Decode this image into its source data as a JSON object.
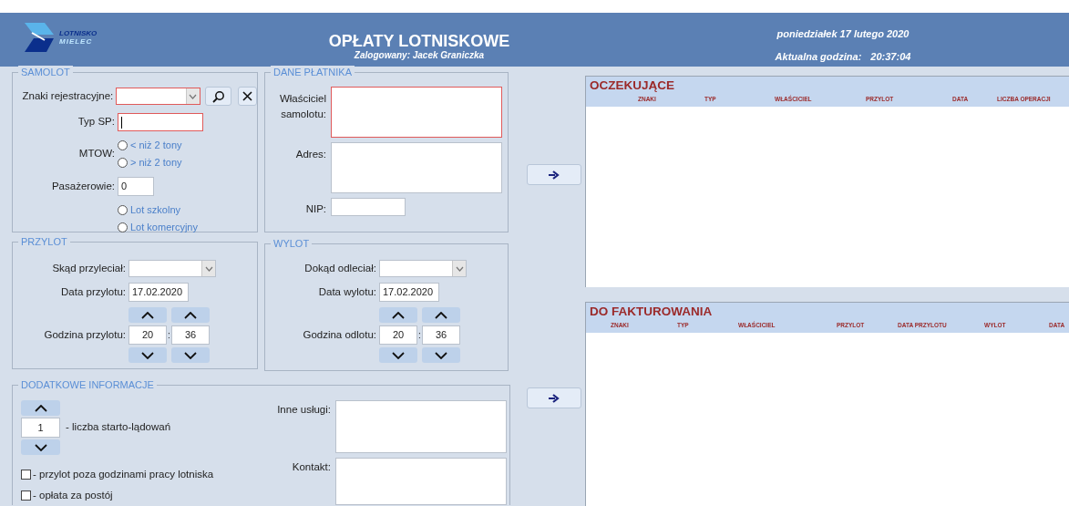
{
  "header": {
    "logo": {
      "line1": "LOTNISKO",
      "line2": "MIELEC"
    },
    "title": "OPŁATY LOTNISKOWE",
    "logged_in": "Zalogowany: Jacek Graniczka",
    "date": "poniedziałek 17 lutego 2020",
    "time_label": "Aktualna godzina:",
    "time": "20:37:04"
  },
  "samolot": {
    "legend": "SAMOLOT",
    "registration": {
      "label": "Znaki rejestracyjne:",
      "flagged": true
    },
    "aircraft_type": {
      "label": "Typ SP:",
      "flagged": true,
      "focused": true
    },
    "mtow": {
      "label": "MTOW:",
      "options": [
        {
          "label": "< niż 2 tony",
          "selected": false
        },
        {
          "label": "> niż 2 tony",
          "selected": false
        }
      ]
    },
    "passengers": {
      "label": "Pasażerowie:",
      "value": "0"
    },
    "flight_type": [
      {
        "label": "Lot szkolny",
        "selected": false
      },
      {
        "label": "Lot komercyjny",
        "selected": false
      }
    ]
  },
  "platnik": {
    "legend": "DANE PŁATNIKA",
    "fields": [
      {
        "label": "Właściciel samolotu:",
        "kind": "area",
        "flagged": true
      },
      {
        "label": "Adres:",
        "kind": "area",
        "flagged": false
      },
      {
        "label": "NIP:",
        "kind": "short",
        "flagged": false
      }
    ]
  },
  "przylot": {
    "legend": "PRZYLOT",
    "place_label": "Skąd przyleciał:",
    "date_label": "Data przylotu:",
    "date": "17.02.2020",
    "time_label": "Godzina przylotu:",
    "hour": "20",
    "separator": ":",
    "minute": "36"
  },
  "wylot": {
    "legend": "WYLOT",
    "place_label": "Dokąd odleciał:",
    "date_label": "Data wylotu:",
    "date": "17.02.2020",
    "time_label": "Godzina odlotu:",
    "hour": "20",
    "separator": ":",
    "minute": "36"
  },
  "dodatkowe": {
    "legend": "DODATKOWE INFORMACJE",
    "count": "1",
    "count_label": "- liczba starto-lądowań",
    "checkboxes": [
      {
        "label": "- przylot poza godzinami pracy lotniska",
        "checked": false
      },
      {
        "label": "- opłata za postój",
        "checked": false
      }
    ],
    "other_services_label": "Inne usługi:",
    "contact_label": "Kontakt:"
  },
  "oczekujace": {
    "title": "OCZEKUJĄCE",
    "columns": [
      "ZNAKI",
      "TYP",
      "WŁAŚCICIEL",
      "PRZYLOT",
      "DATA",
      "LICZBA OPERACJI"
    ]
  },
  "do_fakturowania": {
    "title": "DO FAKTUROWANIA",
    "columns": [
      "ZNAKI",
      "TYP",
      "WŁAŚCICIEL",
      "PRZYLOT",
      "DATA PRZYLOTU",
      "WYLOT",
      "DATA"
    ]
  }
}
